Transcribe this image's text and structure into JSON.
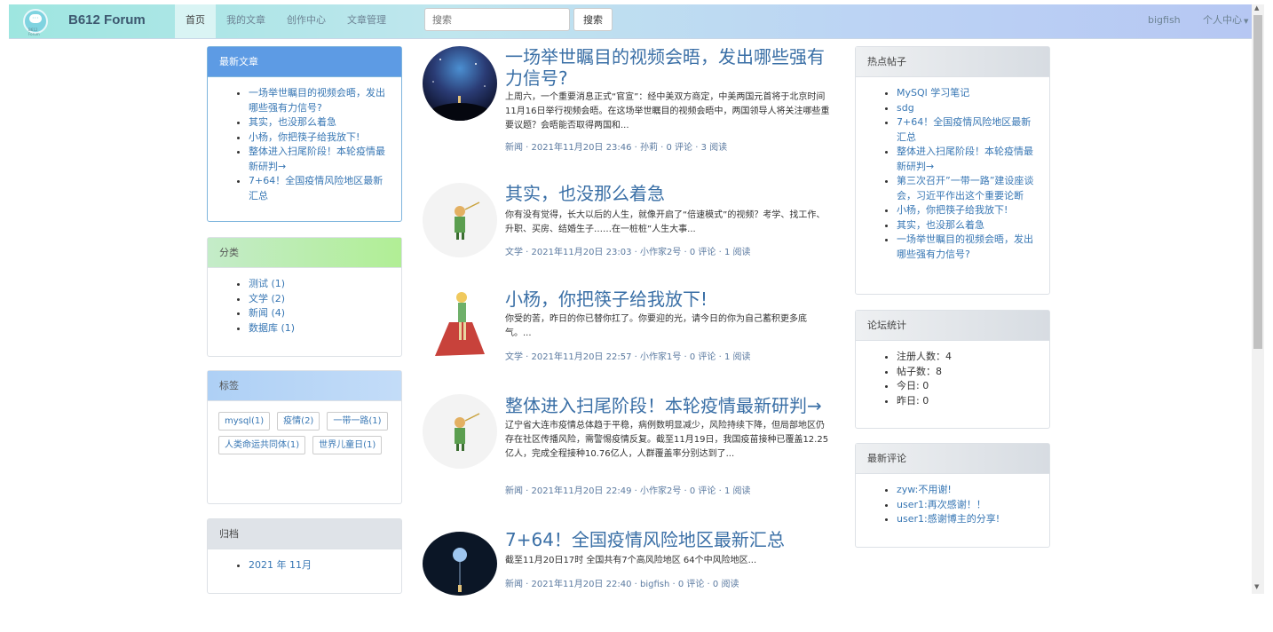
{
  "navbar": {
    "logo_text": "B612 Forum",
    "brand": "B612 Forum",
    "links": [
      {
        "label": "首页"
      },
      {
        "label": "我的文章"
      },
      {
        "label": "创作中心"
      },
      {
        "label": "文章管理"
      }
    ],
    "search_placeholder": "搜索",
    "search_button": "搜索",
    "user": "bigfish",
    "profile": "个人中心"
  },
  "latest": {
    "title": "最新文章",
    "items": [
      "一场举世瞩目的视频会晤，发出哪些强有力信号?",
      "其实，也没那么着急",
      "小杨，你把筷子给我放下!",
      "整体进入扫尾阶段！本轮疫情最新研判→",
      "7+64！全国疫情风险地区最新汇总"
    ]
  },
  "categories": {
    "title": "分类",
    "items": [
      "测试 (1)",
      "文学 (2)",
      "新闻 (4)",
      "数据库 (1)"
    ]
  },
  "tags": {
    "title": "标签",
    "items": [
      "mysql(1)",
      "疫情(2)",
      "一带一路(1)",
      "人类命运共同体(1)",
      "世界儿童日(1)"
    ]
  },
  "archive": {
    "title": "归档",
    "items": [
      "2021 年 11月"
    ]
  },
  "articles": [
    {
      "title": "一场举世瞩目的视频会晤，发出哪些强有力信号?",
      "summary": "上周六，一个重要消息正式“官宣”：经中美双方商定，中美两国元首将于北京时间11月16日举行视频会晤。在这场举世瞩目的视频会晤中，两国领导人将关注哪些重要议题？会晤能否取得两国和...",
      "meta": "新闻 · 2021年11月20日 23:46 · 孙莉 · 0 评论 · 3 阅读"
    },
    {
      "title": "其实，也没那么着急",
      "summary": "你有没有觉得，长大以后的人生，就像开启了“倍速模式”的视频？考学、找工作、升职、买房、结婚生子……在一桩桩”人生大事...",
      "meta": "文学 · 2021年11月20日 23:03 · 小作家2号 · 0 评论 · 1 阅读"
    },
    {
      "title": "小杨，你把筷子给我放下!",
      "summary": "你受的苦，昨日的你已替你扛了。你要迎的光，请今日的你为自己蓄积更多底气。...",
      "meta": "文学 · 2021年11月20日 22:57 · 小作家1号 · 0 评论 · 1 阅读"
    },
    {
      "title": "整体进入扫尾阶段！本轮疫情最新研判→",
      "summary": "辽宁省大连市疫情总体趋于平稳，病例数明显减少，风险持续下降，但局部地区仍存在社区传播风险，需警惕疫情反复。截至11月19日，我国疫苗接种已覆盖12.25亿人，完成全程接种10.76亿人，人群覆盖率分别达到了...",
      "meta": "新闻 · 2021年11月20日 22:49 · 小作家2号 · 0 评论 · 1 阅读"
    },
    {
      "title": "7+64！全国疫情风险地区最新汇总",
      "summary": "截至11月20日17时 全国共有7个高风险地区 64个中风险地区...",
      "meta": "新闻 · 2021年11月20日 22:40 · bigfish · 0 评论 · 0 阅读"
    }
  ],
  "hot": {
    "title": "热点帖子",
    "items": [
      "MySQl 学习笔记",
      "sdg",
      "7+64！全国疫情风险地区最新汇总",
      "整体进入扫尾阶段！本轮疫情最新研判→",
      "第三次召开”一带一路”建设座谈会，习近平作出这个重要论断",
      "小杨，你把筷子给我放下!",
      "其实，也没那么着急",
      "一场举世瞩目的视频会晤，发出哪些强有力信号?"
    ]
  },
  "stats": {
    "title": "论坛统计",
    "items": [
      "注册人数：4",
      "帖子数：8",
      "今日: 0",
      "昨日: 0"
    ]
  },
  "comments": {
    "title": "最新评论",
    "items": [
      "zyw:不用谢!",
      "user1:再次感谢！！",
      "user1:感谢博主的分享!"
    ]
  }
}
